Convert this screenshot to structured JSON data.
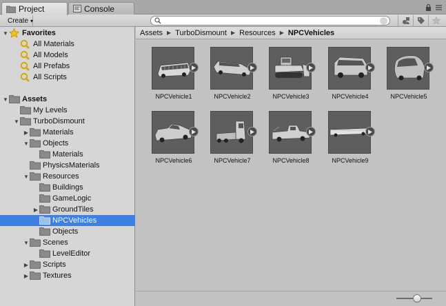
{
  "tabs": [
    {
      "label": "Project",
      "icon": "folder-icon"
    },
    {
      "label": "Console",
      "icon": "console-icon"
    }
  ],
  "toolbar": {
    "create_label": "Create",
    "search_placeholder": "",
    "buttons": [
      "filter-by-type-icon",
      "filter-by-label-icon",
      "favorite-star-icon"
    ]
  },
  "tree": {
    "favorites": {
      "label": "Favorites",
      "items": [
        "All Materials",
        "All Models",
        "All Prefabs",
        "All Scripts"
      ]
    },
    "assets": {
      "label": "Assets",
      "my_levels": "My Levels",
      "turbo": "TurboDismount",
      "materials": "Materials",
      "objects": "Objects",
      "objects_materials": "Materials",
      "physics": "PhysicsMaterials",
      "resources": "Resources",
      "buildings": "Buildings",
      "gamelogic": "GameLogic",
      "groundtiles": "GroundTiles",
      "npcvehicles": "NPCVehicles",
      "res_objects": "Objects",
      "scenes": "Scenes",
      "leveleditor": "LevelEditor",
      "scripts": "Scripts",
      "textures": "Textures"
    }
  },
  "breadcrumb": [
    "Assets",
    "TurboDismount",
    "Resources",
    "NPCVehicles"
  ],
  "assets_grid": [
    {
      "label": "NPCVehicle1",
      "kind": "bus"
    },
    {
      "label": "NPCVehicle2",
      "kind": "limo"
    },
    {
      "label": "NPCVehicle3",
      "kind": "bulldozer"
    },
    {
      "label": "NPCVehicle4",
      "kind": "van"
    },
    {
      "label": "NPCVehicle5",
      "kind": "microcar"
    },
    {
      "label": "NPCVehicle6",
      "kind": "pickup"
    },
    {
      "label": "NPCVehicle7",
      "kind": "semi-truck"
    },
    {
      "label": "NPCVehicle8",
      "kind": "tow-truck"
    },
    {
      "label": "NPCVehicle9",
      "kind": "trailer"
    }
  ],
  "colors": {
    "selection": "#3d80df",
    "folder": "#8a8a8a",
    "star": "#f2c417"
  }
}
